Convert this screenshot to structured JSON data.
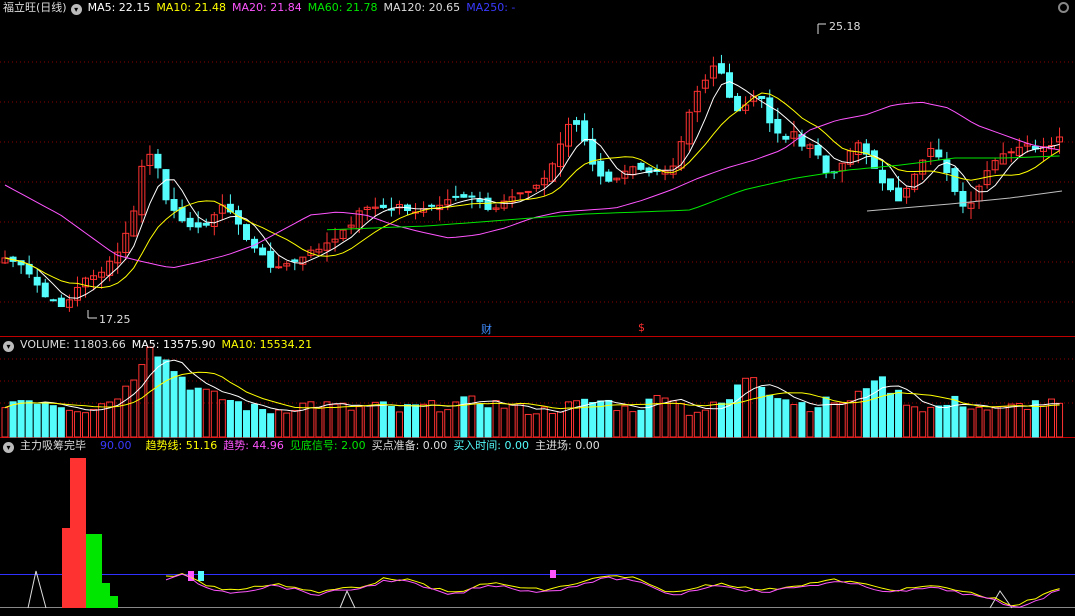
{
  "main_header": {
    "stock_name": "福立旺(日线)",
    "ma5": "MA5: 22.15",
    "ma10": "MA10: 21.48",
    "ma20": "MA20: 21.84",
    "ma60": "MA60: 21.78",
    "ma120": "MA120: 20.65",
    "ma250": "MA250: -"
  },
  "price_labels": {
    "high": "25.18",
    "low": "17.25"
  },
  "markers": {
    "finance": "财",
    "dividend": "$"
  },
  "volume_header": {
    "title": "VOLUME: 11803.66",
    "ma5": "MA5: 13575.90",
    "ma10": "MA10: 15534.21"
  },
  "indicator_header": {
    "name": "主力吸筹完毕",
    "level": "90.00",
    "trend_line": "趋势线: 51.16",
    "trend": "趋势: 44.96",
    "bottom_signal": "见底信号: 2.00",
    "buy_prepare": "买点准备: 0.00",
    "buy_time": "买入时间: 0.00",
    "main_entry": "主进场: 0.00"
  },
  "colors": {
    "up": "#ff3232",
    "down": "#54fcfc",
    "ma5": "#ffffff",
    "ma10": "#ffff00",
    "ma20": "#ff55ff",
    "ma60": "#00e600",
    "ma120": "#c0c0c0",
    "ma250": "#3030ff",
    "grid": "#8b0000",
    "separator": "#c00000"
  }
}
